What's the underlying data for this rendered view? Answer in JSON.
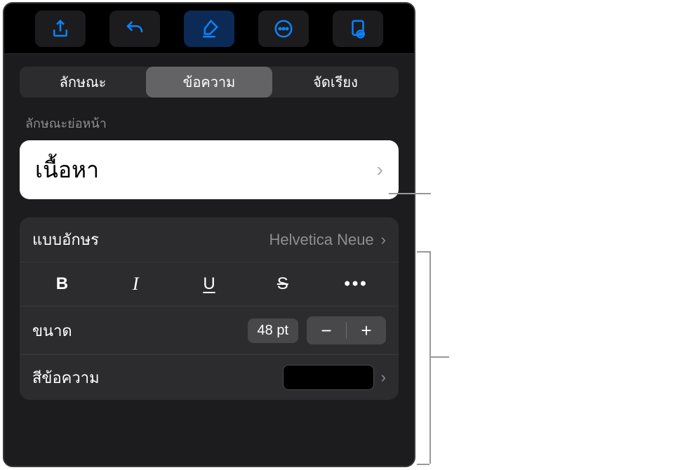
{
  "toolbar": {
    "icons": [
      "share-icon",
      "undo-icon",
      "format-brush-icon",
      "more-icon",
      "document-view-icon"
    ]
  },
  "tabs": {
    "style": "ลักษณะ",
    "text": "ข้อความ",
    "arrange": "จัดเรียง"
  },
  "paragraph": {
    "section_label": "ลักษณะย่อหน้า",
    "current_style": "เนื้อหา"
  },
  "font": {
    "label": "แบบอักษร",
    "value": "Helvetica Neue",
    "bold": "B",
    "italic": "I",
    "underline": "U",
    "strike": "S",
    "more": "•••"
  },
  "size": {
    "label": "ขนาด",
    "value": "48 pt",
    "minus": "−",
    "plus": "+"
  },
  "color": {
    "label": "สีข้อความ",
    "swatch": "#000000"
  }
}
